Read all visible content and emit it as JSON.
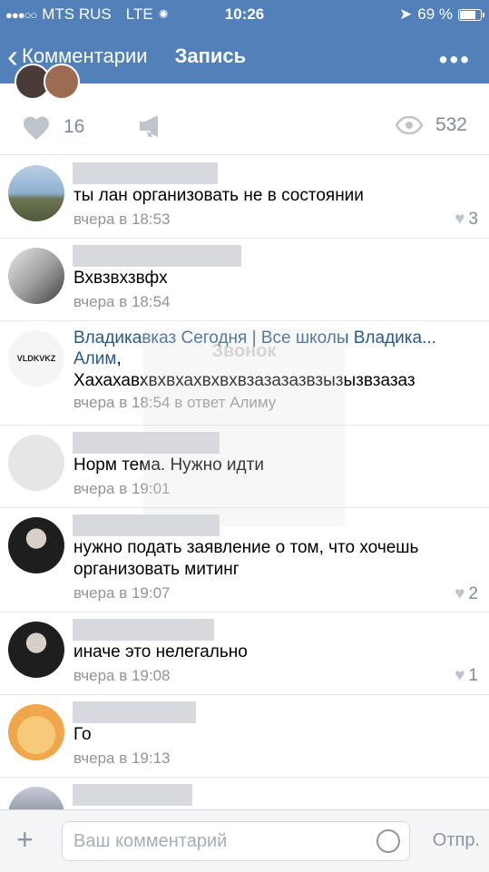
{
  "status_bar": {
    "carrier": "MTS RUS",
    "network": "LTE",
    "time": "10:26",
    "battery": "69 %"
  },
  "nav": {
    "back_label": "Комментарии",
    "title": "Запись",
    "more": "•••"
  },
  "stats": {
    "likes": "16",
    "views": "532"
  },
  "comments": [
    {
      "text": "ты лан организовать не в состоянии",
      "time": "вчера в 18:53",
      "likes": "3"
    },
    {
      "text": "Вхвзвхзвфх",
      "time": "вчера в 18:54",
      "likes": ""
    },
    {
      "author": "Владикавказ Сегодня | Все школы Владика...",
      "reply_to": "Алим",
      "text": "Хахахавхвхвхахвхвхвзазазазвзызызвзазаз",
      "time": "вчера в 18:54 в ответ Алиму",
      "avatar_label": "VLDKVKZ"
    },
    {
      "text": "Норм тема. Нужно идти",
      "time": "вчера в 19:01"
    },
    {
      "text": "нужно подать заявление о том, что хочешь организовать митинг",
      "time": "вчера в 19:07",
      "likes": "2"
    },
    {
      "text": "иначе это нелегально",
      "time": "вчера в 19:08",
      "likes": "1"
    },
    {
      "text": "Го",
      "time": "вчера в 19:13"
    }
  ],
  "overlay_text": "Звонок",
  "composer": {
    "placeholder": "Ваш комментарий",
    "send": "Отпр."
  },
  "colors": {
    "header": "#5181b8",
    "link": "#2a5885",
    "meta": "#939393"
  }
}
